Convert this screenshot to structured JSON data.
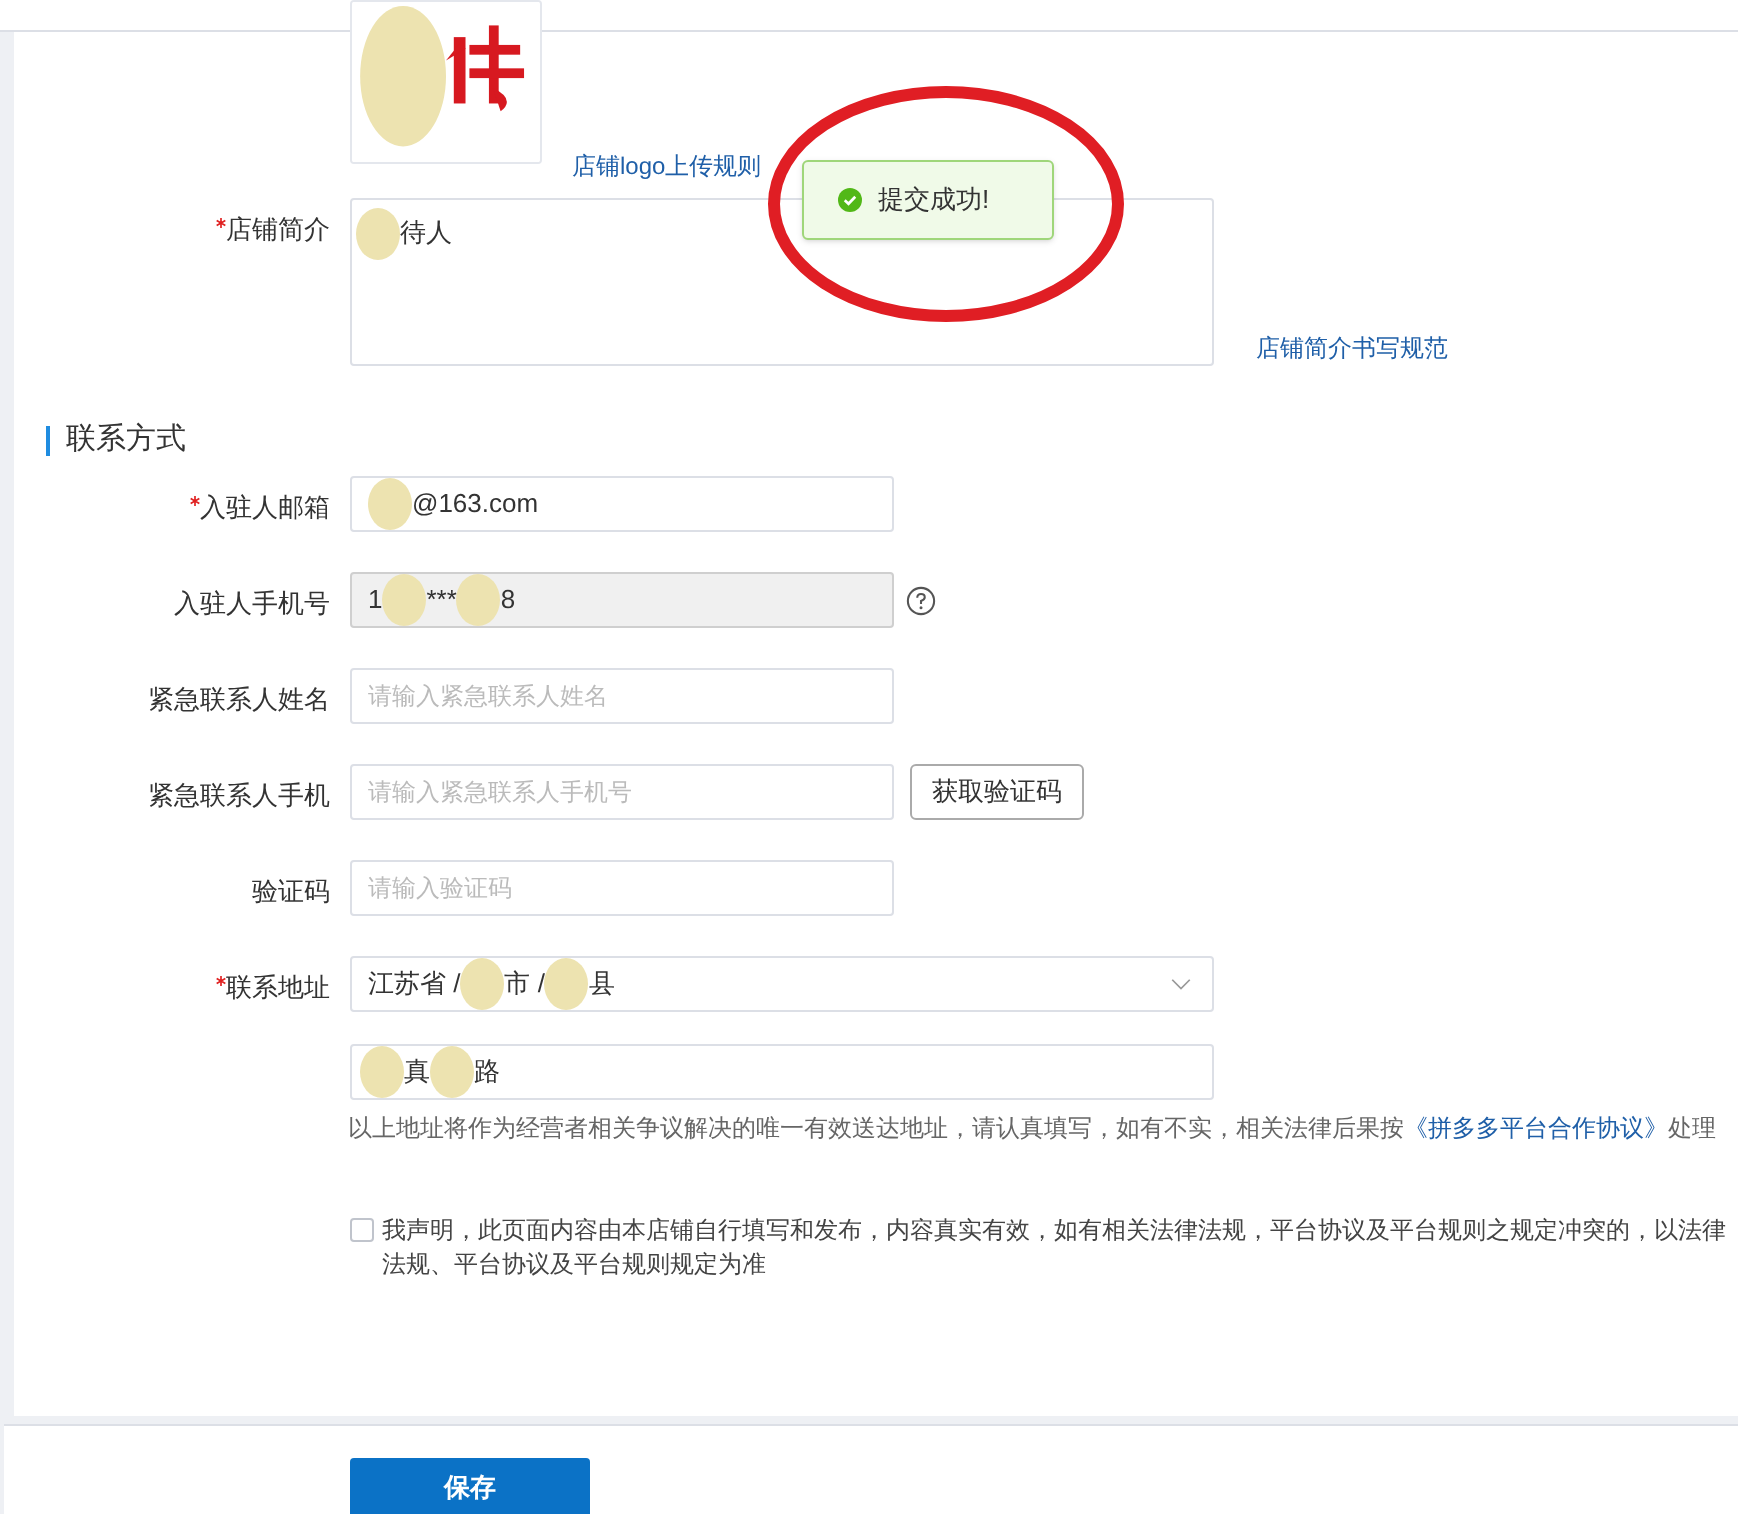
{
  "logo": {
    "rule_link": "店铺logo上传规则"
  },
  "intro": {
    "label": "店铺简介",
    "required": true,
    "value": [
      {
        "kind": "redacted"
      },
      {
        "kind": "text",
        "text": "待人"
      }
    ],
    "rule_link": "店铺简介书写规范"
  },
  "toast": {
    "text": "提交成功!"
  },
  "section": {
    "title": "联系方式"
  },
  "fields": [
    {
      "kind": "input",
      "label": "入驻人邮箱",
      "required": true,
      "disabled": false,
      "value": [
        {
          "kind": "redacted"
        },
        {
          "kind": "text",
          "text": "@163.com"
        }
      ]
    },
    {
      "kind": "input",
      "label": "入驻人手机号",
      "required": false,
      "disabled": true,
      "help": true,
      "value": [
        {
          "kind": "text",
          "text": "1"
        },
        {
          "kind": "redacted"
        },
        {
          "kind": "text",
          "text": "***"
        },
        {
          "kind": "redacted"
        },
        {
          "kind": "text",
          "text": "8"
        }
      ]
    },
    {
      "kind": "input",
      "label": "紧急联系人姓名",
      "required": false,
      "disabled": false,
      "placeholder": "请输入紧急联系人姓名"
    },
    {
      "kind": "input",
      "label": "紧急联系人手机",
      "required": false,
      "disabled": false,
      "placeholder": "请输入紧急联系人手机号",
      "button": "获取验证码"
    },
    {
      "kind": "input",
      "label": "验证码",
      "required": false,
      "disabled": false,
      "placeholder": "请输入验证码"
    },
    {
      "kind": "address",
      "label": "联系地址",
      "required": true,
      "region": [
        {
          "kind": "text",
          "text": "江苏省 /"
        },
        {
          "kind": "redacted"
        },
        {
          "kind": "text",
          "text": "市 /"
        },
        {
          "kind": "redacted"
        },
        {
          "kind": "text",
          "text": "县"
        }
      ],
      "street": [
        {
          "kind": "redacted"
        },
        {
          "kind": "text",
          "text": "真"
        },
        {
          "kind": "redacted"
        },
        {
          "kind": "text",
          "text": "路"
        }
      ],
      "hint": "以上地址将作为经营者相关争议解决的唯一有效送达地址，请认真填写，如有不实，相关法律后果按",
      "hint_link": "《拼多多平台合作协议》",
      "hint_end": "处理"
    }
  ],
  "declaration": {
    "checked": false,
    "text": "我声明，此页面内容由本店铺自行填写和发布，内容真实有效，如有相关法律法规，平台协议及平台规则之规定冲突的，以法律法规、平台协议及平台规则规定为准"
  },
  "save_button": "保存"
}
